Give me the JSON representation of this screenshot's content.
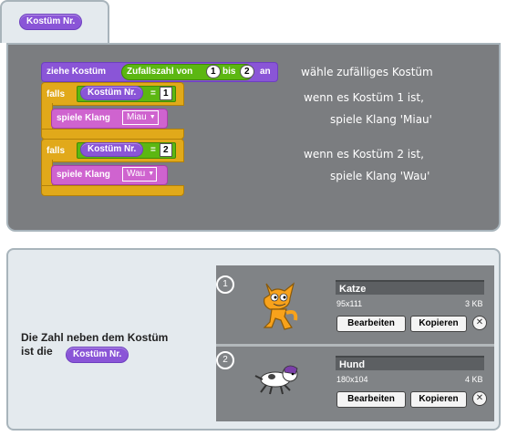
{
  "tab": {
    "label": "Kostüm Nr."
  },
  "script": {
    "block1": {
      "verb": "ziehe Kostüm",
      "reporter": "Zufallszahl von",
      "from": "1",
      "mid": "bis",
      "to": "2",
      "suffix": "an"
    },
    "if1": {
      "keyword": "falls",
      "reporter": "Kostüm Nr.",
      "op": "=",
      "value": "1"
    },
    "sound1": {
      "verb": "spiele Klang",
      "sound": "Miau"
    },
    "if2": {
      "keyword": "falls",
      "reporter": "Kostüm Nr.",
      "op": "=",
      "value": "2"
    },
    "sound2": {
      "verb": "spiele Klang",
      "sound": "Wau"
    }
  },
  "notes": [
    "wähle zufälliges Kostüm",
    "wenn es Kostüm 1 ist,",
    "spiele Klang 'Miau'",
    "wenn es Kostüm 2 ist,",
    "spiele Klang 'Wau'"
  ],
  "lower": {
    "line1": "Die Zahl neben dem Kostüm",
    "line2": "ist die",
    "reporter": "Kostüm Nr."
  },
  "costumes": [
    {
      "number": "1",
      "name": "Katze",
      "dims": "95x111",
      "size": "3 KB",
      "edit": "Bearbeiten",
      "copy": "Kopieren",
      "icon": "cat-sprite-icon"
    },
    {
      "number": "2",
      "name": "Hund",
      "dims": "180x104",
      "size": "4 KB",
      "edit": "Bearbeiten",
      "copy": "Kopieren",
      "icon": "dog-sprite-icon"
    }
  ]
}
